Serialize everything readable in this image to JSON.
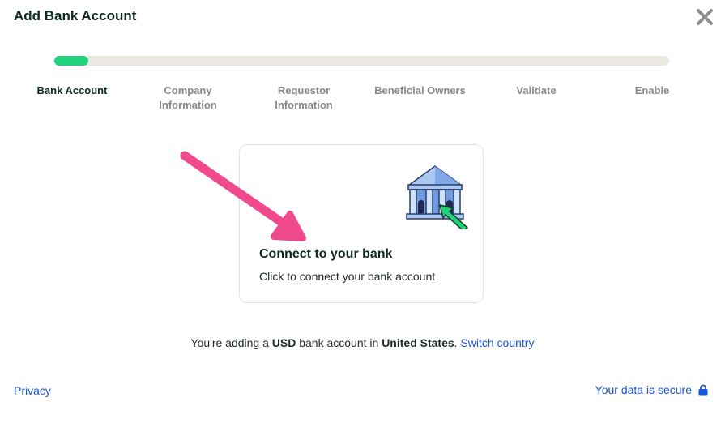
{
  "header": {
    "title": "Add Bank Account",
    "close_icon": "close-icon"
  },
  "progress": {
    "value": 0.055,
    "fill_color": "#1fd37a",
    "track_color": "#ebe7e1"
  },
  "steps": [
    {
      "label": "Bank Account",
      "active": true
    },
    {
      "label": "Company\nInformation",
      "active": false
    },
    {
      "label": "Requestor\nInformation",
      "active": false
    },
    {
      "label": "Beneficial Owners",
      "active": false
    },
    {
      "label": "Validate",
      "active": false
    },
    {
      "label": "Enable",
      "active": false
    }
  ],
  "card": {
    "title": "Connect to your bank",
    "subtitle": "Click to connect your bank account",
    "icon": "bank-icon"
  },
  "country": {
    "prefix": "You're adding a ",
    "currency": "USD",
    "middle": " bank account in ",
    "country": "United States",
    "suffix": ".",
    "switch_label": "Switch country"
  },
  "footer": {
    "privacy_label": "Privacy",
    "secure_label": "Your data is secure",
    "lock_icon": "lock-icon"
  },
  "colors": {
    "accent_link": "#1a56db",
    "annotation_arrow": "#f0498c"
  }
}
